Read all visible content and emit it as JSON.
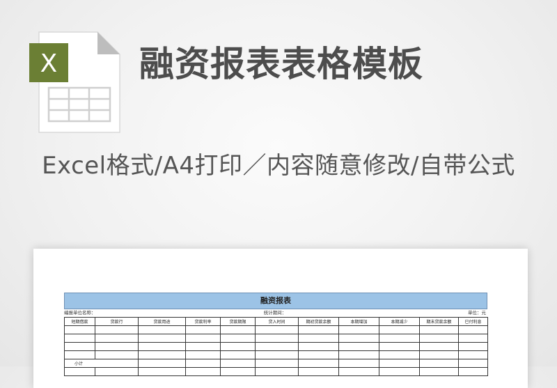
{
  "header": {
    "title": "融资报表表格模板",
    "subtitle": "Excel格式/A4打印／内容随意修改/自带公式",
    "file_icon": {
      "name": "excel-file-icon",
      "letter": "X",
      "badge_color": "#6b7f34"
    }
  },
  "sheet": {
    "title": "融资报表",
    "meta_left": "编报单位名称：",
    "meta_center": "统计期间：",
    "meta_right": "单位：元",
    "columns": [
      "短期借款",
      "贷款行",
      "贷款用途",
      "贷款利率",
      "贷款期限",
      "贷入时间",
      "期初贷款余额",
      "本期增加",
      "本期减少",
      "期末贷款余额",
      "已付利息"
    ],
    "subtotal_label": "小计",
    "accent_color": "#9cc3e6"
  }
}
